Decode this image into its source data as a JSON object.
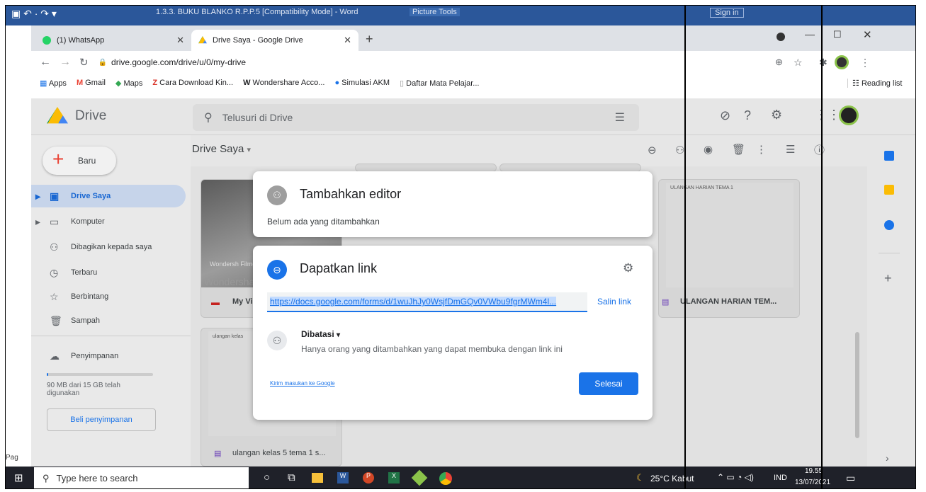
{
  "word": {
    "title": "1.3.3. BUKU BLANKO  R.P.P.5 [Compatibility Mode]  -  Word",
    "tools": "Picture Tools",
    "signin": "Sign in",
    "pag": "Pag"
  },
  "tabs": [
    {
      "label": "(1) WhatsApp"
    },
    {
      "label": "Drive Saya - Google Drive"
    }
  ],
  "address": {
    "url": "drive.google.com/drive/u/0/my-drive"
  },
  "bookmarks": [
    "Apps",
    "Gmail",
    "Maps",
    "Cara Download Kin...",
    "Wondershare Acco...",
    "Simulasi AKM",
    "Daftar Mata Pelajar..."
  ],
  "reading_list": "Reading list",
  "drive": {
    "logo": "Drive",
    "search_placeholder": "Telusuri di Drive",
    "breadcrumb": "Drive Saya",
    "new_button": "Baru"
  },
  "sidebar": {
    "items": [
      {
        "label": "Drive Saya"
      },
      {
        "label": "Komputer"
      },
      {
        "label": "Dibagikan kepada saya"
      },
      {
        "label": "Terbaru"
      },
      {
        "label": "Berbintang"
      },
      {
        "label": "Sampah"
      }
    ],
    "storage_label": "Penyimpanan",
    "storage_text": "90 MB dari 15 GB telah digunakan",
    "storage_fraction": 0.006,
    "buy_button": "Beli penyimpanan"
  },
  "files": [
    {
      "name": "My Vi"
    },
    {
      "name": "ULANGAN HARIAN TEM..."
    },
    {
      "name": "ulangan kelas 5 tema 1 s..."
    }
  ],
  "thumb_texts": {
    "video_brand": "Wondersh Filmora",
    "video_wm": "Wondershar",
    "doc_title": "ULANGAN HARIAN TEMA 1",
    "doc2_title": "ulangan kelas"
  },
  "dialog_editor": {
    "title": "Tambahkan editor",
    "subtitle": "Belum ada yang ditambahkan"
  },
  "dialog_link": {
    "title": "Dapatkan link",
    "url": "https://docs.google.com/forms/d/1wuJhJy0WsjfDmGQv0VWbu9fgrMWm4l...",
    "copy": "Salin link",
    "access": "Dibatasi",
    "access_desc": "Hanya orang yang ditambahkan yang dapat membuka dengan link ini",
    "feedback": "Kirim masukan ke Google",
    "done": "Selesai"
  },
  "taskbar": {
    "search_placeholder": "Type here to search",
    "weather": "25°C  Kabut",
    "lang": "IND",
    "time": "19.55",
    "date": "13/07/2021"
  },
  "colors": {
    "accent": "#1a73e8",
    "selection": "#c2dbff",
    "taskbar": "#1f2129"
  }
}
